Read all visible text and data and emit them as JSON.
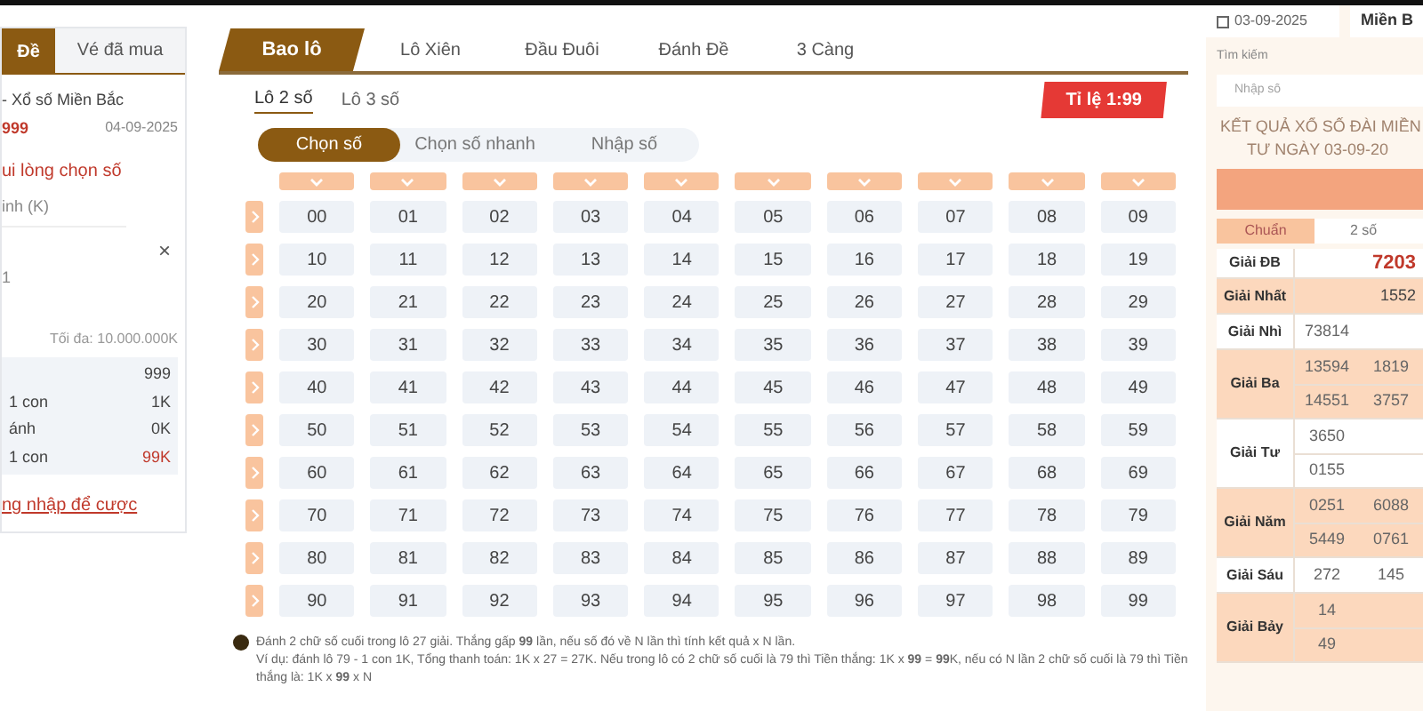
{
  "left_panel": {
    "tabs": [
      {
        "label": "Đề",
        "selected": true
      },
      {
        "label": "Vé đã mua",
        "selected": false
      }
    ],
    "lottery": "- Xổ số Miền Bắc",
    "code": "999",
    "date": "04-09-2025",
    "prompt": "ui lòng chọn số",
    "amount_label": "inh (K)",
    "clear": "×",
    "count": "1",
    "max_note": "Tối đa: 10.000.000K",
    "summary": [
      {
        "value": "999",
        "kind": "plain"
      },
      {
        "label": "1 con",
        "value": "1K",
        "kind": "plain"
      },
      {
        "label": "ánh",
        "value": "0K",
        "kind": "plain"
      },
      {
        "label": "1 con",
        "value": "99K",
        "kind": "win"
      }
    ],
    "link": "ng nhập để cược"
  },
  "game": {
    "tabs": [
      {
        "label": "Bao lô",
        "selected": true
      },
      {
        "label": "Lô Xiên",
        "selected": false
      },
      {
        "label": "Đầu Đuôi",
        "selected": false
      },
      {
        "label": "Đánh Đề",
        "selected": false
      },
      {
        "label": "3 Càng",
        "selected": false
      }
    ],
    "subtabs": [
      {
        "label": "Lô 2 số",
        "selected": true
      },
      {
        "label": "Lô 3 số",
        "selected": false
      }
    ],
    "ratio": "Tỉ lệ 1:99",
    "modes": [
      {
        "label": "Chọn số",
        "selected": true
      },
      {
        "label": "Chọn số nhanh",
        "selected": false
      },
      {
        "label": "Nhập số",
        "selected": false
      }
    ],
    "grid": [
      [
        "00",
        "01",
        "02",
        "03",
        "04",
        "05",
        "06",
        "07",
        "08",
        "09"
      ],
      [
        "10",
        "11",
        "12",
        "13",
        "14",
        "15",
        "16",
        "17",
        "18",
        "19"
      ],
      [
        "20",
        "21",
        "22",
        "23",
        "24",
        "25",
        "26",
        "27",
        "28",
        "29"
      ],
      [
        "30",
        "31",
        "32",
        "33",
        "34",
        "35",
        "36",
        "37",
        "38",
        "39"
      ],
      [
        "40",
        "41",
        "42",
        "43",
        "44",
        "45",
        "46",
        "47",
        "48",
        "49"
      ],
      [
        "50",
        "51",
        "52",
        "53",
        "54",
        "55",
        "56",
        "57",
        "58",
        "59"
      ],
      [
        "60",
        "61",
        "62",
        "63",
        "64",
        "65",
        "66",
        "67",
        "68",
        "69"
      ],
      [
        "70",
        "71",
        "72",
        "73",
        "74",
        "75",
        "76",
        "77",
        "78",
        "79"
      ],
      [
        "80",
        "81",
        "82",
        "83",
        "84",
        "85",
        "86",
        "87",
        "88",
        "89"
      ],
      [
        "90",
        "91",
        "92",
        "93",
        "94",
        "95",
        "96",
        "97",
        "98",
        "99"
      ]
    ],
    "note": [
      "Đánh 2 chữ số cuối trong lô 27 giải. Thắng gấp **99** lần, nếu số đó về N lần thì tính kết quả x N lần.",
      "Ví dụ: đánh lô 79 - 1 con 1K, Tổng thanh toán: 1K x 27 = 27K. Nếu trong lô có 2 chữ số cuối là 79 thì Tiền thắng: 1K x **99** = **99**K, nếu có N lần 2 chữ số cuối là 79 thì Tiền thắng là: 1K x **99** x N"
    ]
  },
  "results": {
    "date": "03-09-2025",
    "region": "Miền B",
    "search_label": "Tìm kiếm",
    "search_placeholder": "Nhập số",
    "title": [
      "KẾT QUẢ XỔ SỐ ĐÀI MIỀN",
      "TƯ NGÀY 03-09-20"
    ],
    "tabs": [
      {
        "label": "Chuẩn",
        "selected": true
      },
      {
        "label": "2 số",
        "selected": false
      }
    ],
    "prizes": [
      {
        "label": "Giải ĐB",
        "kind": "special",
        "lines": [
          [
            "7203"
          ]
        ]
      },
      {
        "label": "Giải Nhất",
        "kind": "normal",
        "lines": [
          [
            "1552"
          ]
        ]
      },
      {
        "label": "Giải Nhì",
        "kind": "normal",
        "lines": [
          [
            "73814"
          ]
        ]
      },
      {
        "label": "Giải Ba",
        "kind": "normal",
        "lines": [
          [
            "13594",
            "1819"
          ],
          [
            "14551",
            "3757"
          ]
        ]
      },
      {
        "label": "Giải Tư",
        "kind": "normal",
        "lines": [
          [
            "3650"
          ],
          [
            "0155"
          ]
        ]
      },
      {
        "label": "Giải Năm",
        "kind": "normal",
        "lines": [
          [
            "0251",
            "6088"
          ],
          [
            "5449",
            "0761"
          ]
        ]
      },
      {
        "label": "Giải Sáu",
        "kind": "normal",
        "lines": [
          [
            "272",
            "145"
          ]
        ]
      },
      {
        "label": "Giải Bảy",
        "kind": "normal",
        "lines": [
          [
            "14"
          ],
          [
            "49"
          ]
        ]
      }
    ]
  }
}
